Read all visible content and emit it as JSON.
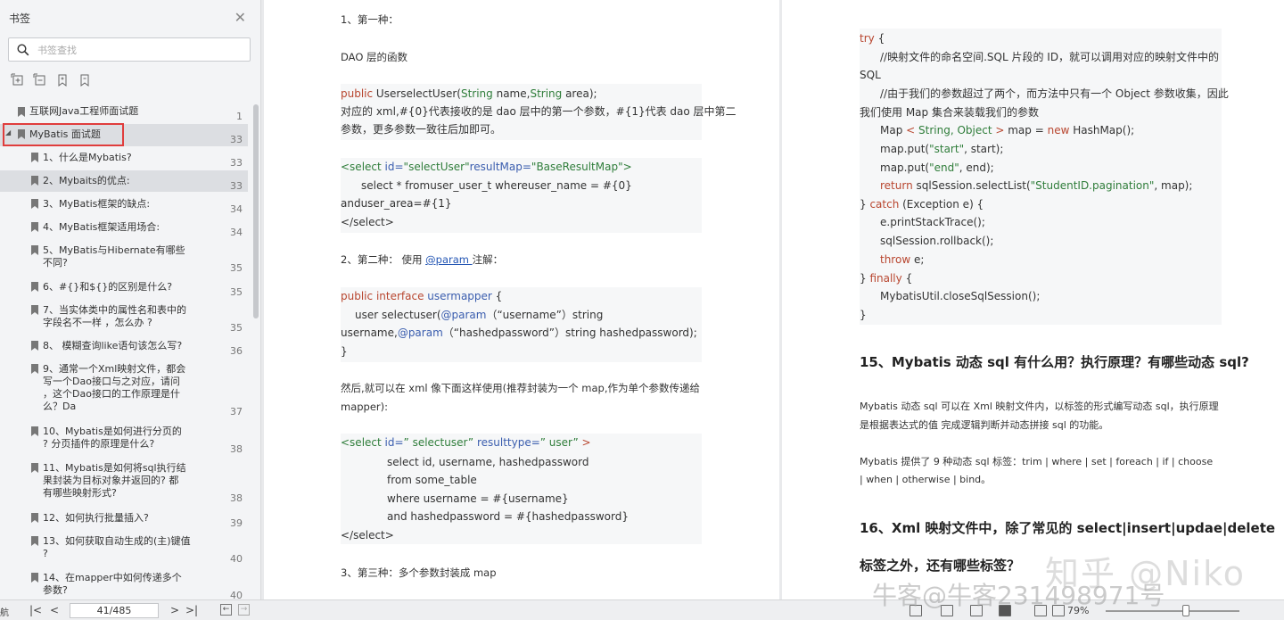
{
  "sidebar": {
    "title": "书签",
    "search_placeholder": "书签查找",
    "bookmarks": [
      {
        "label": "互联网Java工程师面试题",
        "page": "1"
      },
      {
        "label": "MyBatis 面试题",
        "page": "33"
      },
      {
        "label": "1、什么是Mybatis?",
        "page": "33"
      },
      {
        "label": "2、Mybaits的优点:",
        "page": "33"
      },
      {
        "label": "3、MyBatis框架的缺点:",
        "page": "34"
      },
      {
        "label": "4、MyBatis框架适用场合:",
        "page": "34"
      },
      {
        "label": "5、MyBatis与Hibernate有哪些",
        "label2": "不同?",
        "page": "35"
      },
      {
        "label": "6、#{}和${}的区别是什么?",
        "page": "35"
      },
      {
        "label": "7、当实体类中的属性名和表中的",
        "label2": "字段名不一样 ，怎么办 ?",
        "page": "35"
      },
      {
        "label": "8、 模糊查询like语句该怎么写?",
        "page": "36"
      },
      {
        "label": "9、通常一个Xml映射文件，都会",
        "label2": "写一个Dao接口与之对应，请问",
        "label3": "，这个Dao接口的工作原理是什",
        "label4": "么？Da",
        "page": "37"
      },
      {
        "label": "10、Mybatis是如何进行分页的",
        "label2": "? 分页插件的原理是什么?",
        "page": "38"
      },
      {
        "label": "11、Mybatis是如何将sql执行结",
        "label2": "果封装为目标对象并返回的? 都",
        "label3": "有哪些映射形式?",
        "page": "38"
      },
      {
        "label": "12、如何执行批量插入?",
        "page": "39"
      },
      {
        "label": "13、如何获取自动生成的(主)键值",
        "label2": "?",
        "page": "40"
      },
      {
        "label": "14、在mapper中如何传递多个",
        "label2": "参数?",
        "page": "40"
      }
    ]
  },
  "page1": {
    "p1": "1、第一种：",
    "p2": "DAO 层的函数",
    "c1": {
      "kw1": "public",
      "t1": " UserselectUser(",
      "ty1": "String",
      "t2": " name,",
      "ty2": "String",
      "t3": " area);",
      "l2": "对应的 xml,#{0}代表接收的是 dao 层中的第一个参数，#{1}代表 dao 层中第二",
      "l3": "参数，更多参数一致往后加即可。"
    },
    "c2": {
      "tag1": "<select",
      "a1": " id=",
      "v1": "\"selectUser\"",
      "a2": "resultMap=",
      "v2": "\"BaseResultMap\"",
      "tag1e": ">",
      "l2": "select *    fromuser_user_t     whereuser_name = #{0}",
      "l3": "anduser_area=#{1}",
      "l4": "</select>"
    },
    "p3a": "2、第二种：  使用 ",
    "p3link": "@param ",
    "p3b": " 注解：",
    "c3": {
      "kw1": "public",
      "kw2": "interface",
      "nm1": "usermapper",
      "t1": " {",
      "l2a": "user selectuser(",
      "l2p": "@param",
      "l2b": "（“username”）string",
      "l3a": "username,",
      "l3p": "@param",
      "l3b": "（“hashedpassword”）string hashedpassword);",
      "l4": "}"
    },
    "p4a": "然后,就可以在 xml 像下面这样使用(推荐封装为一个 map,作为单个参数传递给",
    "p4b": "mapper):",
    "c4": {
      "tag1": "<select",
      "a1": " id=",
      "v1": "”  selectuser”",
      "a2": "   resulttype=",
      "v2": "”  user”",
      "tag1e": "  >",
      "l2": "select id, username, hashedpassword",
      "l3": "from some_table",
      "l4": "where username = #{username}",
      "l5": "and hashedpassword = #{hashedpassword}",
      "l6": "</select>"
    },
    "p5": "3、第三种：多个参数封装成 map"
  },
  "page2": {
    "code": {
      "try": "try",
      "try_b": " {",
      "c1": "//映射文件的命名空间.SQL 片段的 ID，就可以调用对应的映射文件中的",
      "c1b": "SQL",
      "c2": "//由于我们的参数超过了两个，而方法中只有一个 Object 参数收集，因此",
      "c2b": "我们使用 Map 集合来装载我们的参数",
      "m1": "Map ",
      "m1lt": "<",
      "m1ty": " String, Object ",
      "m1gt": ">",
      "m1b": " map = ",
      "m1new": "new",
      "m1c": " HashMap();",
      "p1a": "map.put(",
      "p1s": "\"start\"",
      "p1b": ", start);",
      "p2a": "map.put(",
      "p2s": "\"end\"",
      "p2b": ", end);",
      "ret": "return",
      "ret_b": " sqlSession.selectList(",
      "ret_s": "\"StudentID.pagination\"",
      "ret_c": ", map);",
      "catch_a": "} ",
      "catch": "catch",
      "catch_b": " (Exception e) {",
      "e1": "e.printStackTrace();",
      "e2": "sqlSession.rollback();",
      "throw": "throw",
      "throw_b": " e;",
      "fin_a": "} ",
      "finally": "finally",
      "fin_b": " {",
      "close": "MybatisUtil.closeSqlSession();",
      "end": "}"
    },
    "h15": "15、Mybatis 动态 sql 有什么用？执行原理？有哪些动态 sql?",
    "p15a": "Mybatis 动态 sql 可以在 Xml 映射文件内，以标签的形式编写动态 sql，执行原理",
    "p15b": "是根据表达式的值 完成逻辑判断并动态拼接 sql 的功能。",
    "p15c": "Mybatis 提供了 9 种动态 sql 标签：trim | where | set | foreach | if | choose",
    "p15d": "| when | otherwise | bind。",
    "h16a": "16、Xml 映射文件中，除了常见的 select|insert|updae|delete",
    "h16b": "标签之外，还有哪些标签？"
  },
  "statusbar": {
    "left_label": "航",
    "page_value": "41/485",
    "zoom": "79%"
  },
  "watermark": {
    "line1": "知乎 @Niko",
    "line2": "牛客@牛客231498971号"
  }
}
